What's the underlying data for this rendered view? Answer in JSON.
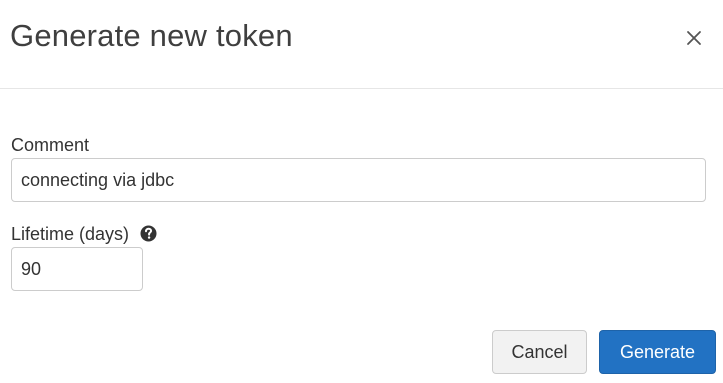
{
  "dialog": {
    "title": "Generate new token",
    "close_icon": "close-icon"
  },
  "form": {
    "comment": {
      "label": "Comment",
      "value": "connecting via jdbc"
    },
    "lifetime": {
      "label": "Lifetime (days)",
      "help_icon": "question-circle-icon",
      "value": "90"
    }
  },
  "actions": {
    "cancel_label": "Cancel",
    "generate_label": "Generate"
  },
  "colors": {
    "primary": "#2272c3",
    "secondary_bg": "#f2f2f2",
    "border": "#cccccc",
    "text": "#333333"
  }
}
